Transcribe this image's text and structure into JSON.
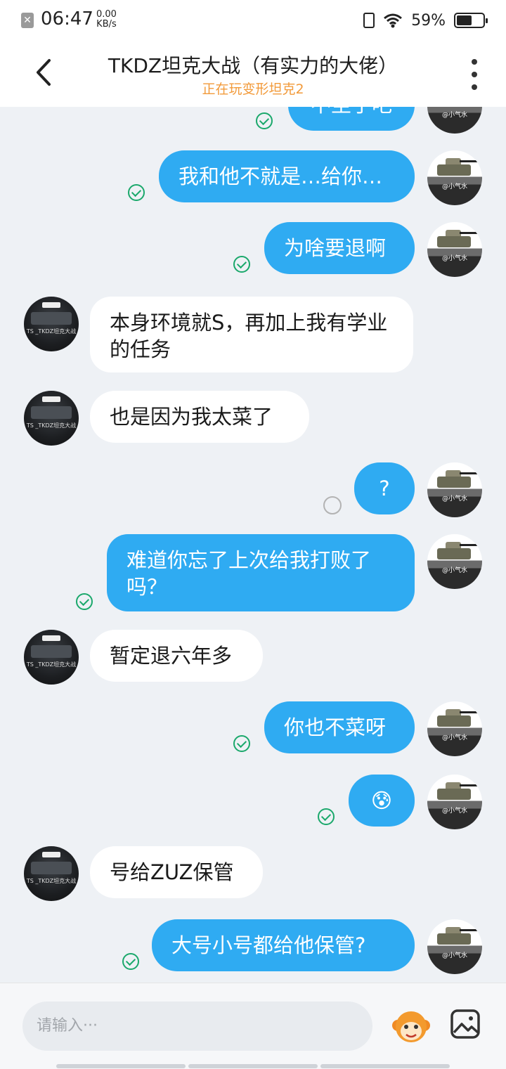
{
  "status_bar": {
    "time": "06:47",
    "speed_value": "0.00",
    "speed_unit": "KB/s",
    "battery": "59%",
    "battery_level": 0.59
  },
  "header": {
    "title": "TKDZ坦克大战（有实力的大佬）",
    "subtitle": "正在玩变形坦克2"
  },
  "avatars": {
    "me_label": "@小气水",
    "them_label": "TS _TKDZ坦克大战"
  },
  "messages": [
    {
      "from": "me",
      "text": "不至于吧",
      "status": "read"
    },
    {
      "from": "me",
      "text": "我和他不就是…给你…",
      "status": "read"
    },
    {
      "from": "me",
      "text": "为啥要退啊",
      "status": "read"
    },
    {
      "from": "them",
      "text": "本身环境就S，再加上我有学业的任务"
    },
    {
      "from": "them",
      "text": "也是因为我太菜了"
    },
    {
      "from": "me",
      "text": "?",
      "status": "pending"
    },
    {
      "from": "me",
      "text": "难道你忘了上次给我打败了吗？",
      "status": "read"
    },
    {
      "from": "them",
      "text": "暂定退六年多"
    },
    {
      "from": "me",
      "text": "你也不菜呀",
      "status": "read"
    },
    {
      "from": "me",
      "text": "😰",
      "status": "read"
    },
    {
      "from": "them",
      "text": "号给ZUZ保管"
    },
    {
      "from": "me",
      "text": "大号小号都给他保管?",
      "status": "read"
    }
  ],
  "input": {
    "placeholder": "请输入···"
  },
  "colors": {
    "bubble_me": "#2fabf2",
    "bubble_them": "#ffffff",
    "read_check": "#1aa86b",
    "subtitle": "#f29a3a"
  }
}
